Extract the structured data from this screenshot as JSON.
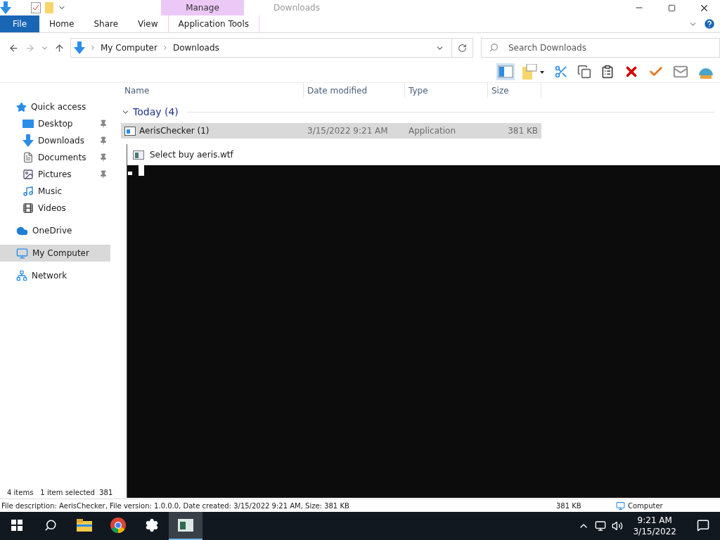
{
  "explorer": {
    "contextual_group": "Manage",
    "title": "Downloads",
    "ribbon_tabs": [
      {
        "label": "File",
        "kind": "file"
      },
      {
        "label": "Home",
        "kind": "plain"
      },
      {
        "label": "Share",
        "kind": "plain"
      },
      {
        "label": "View",
        "kind": "plain"
      },
      {
        "label": "Application Tools",
        "kind": "contextual"
      }
    ],
    "address": {
      "path": [
        "My Computer",
        "Downloads"
      ]
    },
    "search": {
      "placeholder": "Search Downloads"
    },
    "sidebar": {
      "items": [
        {
          "label": "Quick access",
          "selected": false,
          "children": [
            {
              "label": "Desktop",
              "pinned": true,
              "selected": false
            },
            {
              "label": "Downloads",
              "pinned": true,
              "selected": false
            },
            {
              "label": "Documents",
              "pinned": true,
              "selected": false
            },
            {
              "label": "Pictures",
              "pinned": true,
              "selected": false
            },
            {
              "label": "Music",
              "pinned": false,
              "selected": false
            },
            {
              "label": "Videos",
              "pinned": false,
              "selected": false
            }
          ]
        },
        {
          "label": "OneDrive",
          "selected": false
        },
        {
          "label": "My Computer",
          "selected": true
        },
        {
          "label": "Network",
          "selected": false
        }
      ]
    },
    "columns": [
      "Name",
      "Date modified",
      "Type",
      "Size"
    ],
    "group": {
      "label": "Today (4)",
      "expanded": true
    },
    "files": [
      {
        "name": "AerisChecker (1)",
        "date": "3/15/2022 9:21 AM",
        "type": "Application",
        "size": "381 KB",
        "selected": true
      }
    ],
    "status_bar": {
      "item_count": "4 items",
      "selection": "1 item selected  381"
    },
    "info_tip": {
      "text": "File description: AerisChecker, File version: 1.0.0.0, Date created: 3/15/2022 9:21 AM, Size: 381 KB",
      "size": "381 KB",
      "location": "Computer"
    }
  },
  "console": {
    "title": "Select buy aeris.wtf"
  },
  "taskbar": {
    "apps": [
      {
        "selected": false
      },
      {
        "selected": false
      },
      {
        "selected": false
      },
      {
        "selected": true
      }
    ],
    "clock": {
      "time": "9:21 AM",
      "date": "3/15/2022"
    }
  }
}
